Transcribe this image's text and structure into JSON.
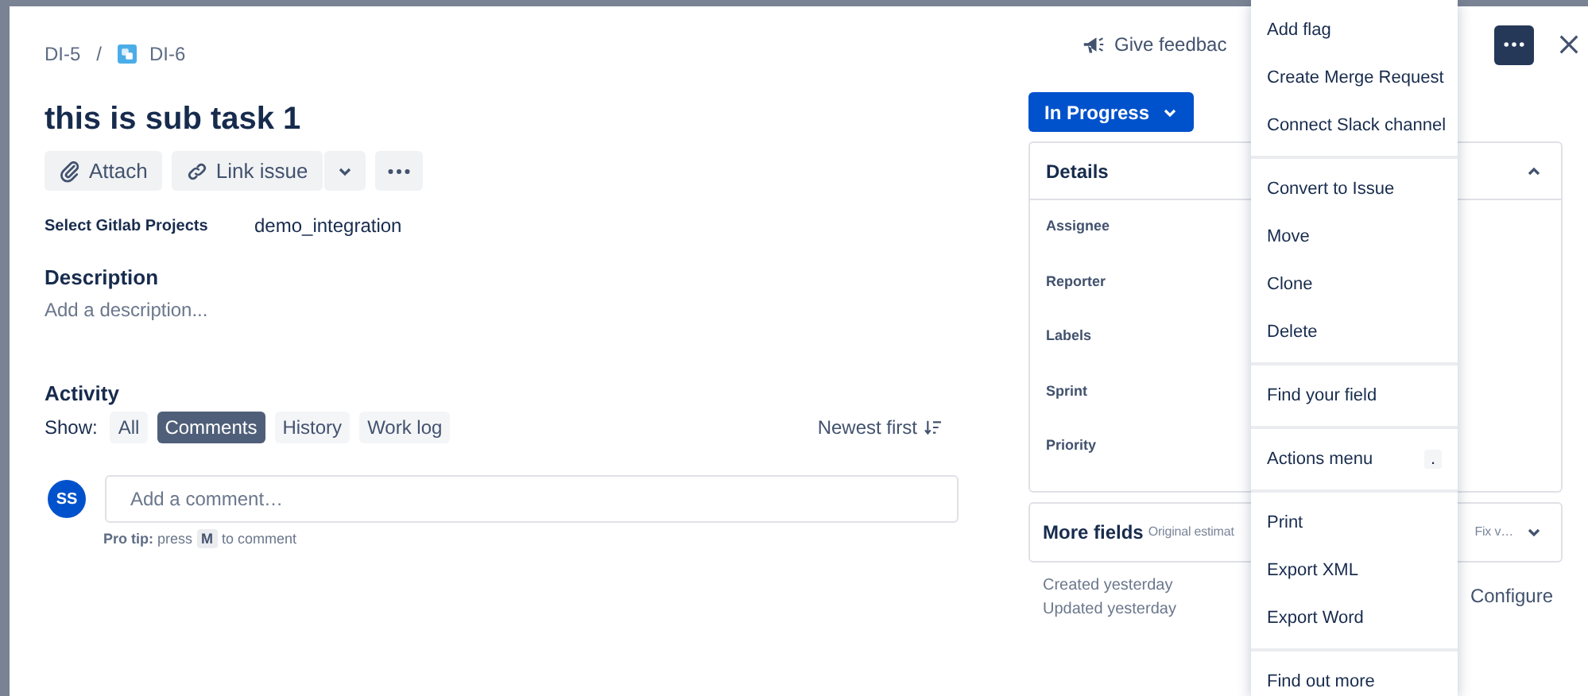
{
  "breadcrumbs": {
    "parent": "DI-5",
    "separator": "/",
    "current": "DI-6"
  },
  "title": "this is sub task 1",
  "toolbar": {
    "attach": "Attach",
    "link": "Link issue"
  },
  "fields": [
    {
      "label": "Select Gitlab Projects",
      "value": "demo_integration"
    }
  ],
  "description": {
    "heading": "Description",
    "placeholder": "Add a description..."
  },
  "activity": {
    "heading": "Activity",
    "show_label": "Show:",
    "sort": "Newest first",
    "filters": [
      {
        "label": "All",
        "selected": false
      },
      {
        "label": "Comments",
        "selected": true
      },
      {
        "label": "History",
        "selected": false
      },
      {
        "label": "Work log",
        "selected": false
      }
    ]
  },
  "comment": {
    "avatar": "SS",
    "placeholder": "Add a comment…",
    "tip_label": "Pro tip:",
    "tip_before": "press",
    "tip_key": "M",
    "tip_after": "to comment"
  },
  "feedback": "Give feedbac",
  "status": "In Progress",
  "details": {
    "title": "Details",
    "expanded": true,
    "fields": [
      "Assignee",
      "Reporter",
      "Labels",
      "Sprint",
      "Priority"
    ]
  },
  "more_fields": {
    "title": "More fields",
    "summary_left": "Original estimat",
    "summary_right": "Fix v…",
    "expanded": false
  },
  "dates": [
    "Created yesterday",
    "Updated yesterday"
  ],
  "configure": "Configure",
  "menu": [
    [
      {
        "label": "Add flag"
      },
      {
        "label": "Create Merge Request"
      },
      {
        "label": "Connect Slack channel"
      }
    ],
    [
      {
        "label": "Convert to Issue"
      },
      {
        "label": "Move"
      },
      {
        "label": "Clone"
      },
      {
        "label": "Delete"
      }
    ],
    [
      {
        "label": "Find your field"
      }
    ],
    [
      {
        "label": "Actions menu",
        "shortcut": "."
      }
    ],
    [
      {
        "label": "Print"
      },
      {
        "label": "Export XML"
      },
      {
        "label": "Export Word"
      }
    ],
    [
      {
        "label": "Find out more"
      }
    ]
  ]
}
